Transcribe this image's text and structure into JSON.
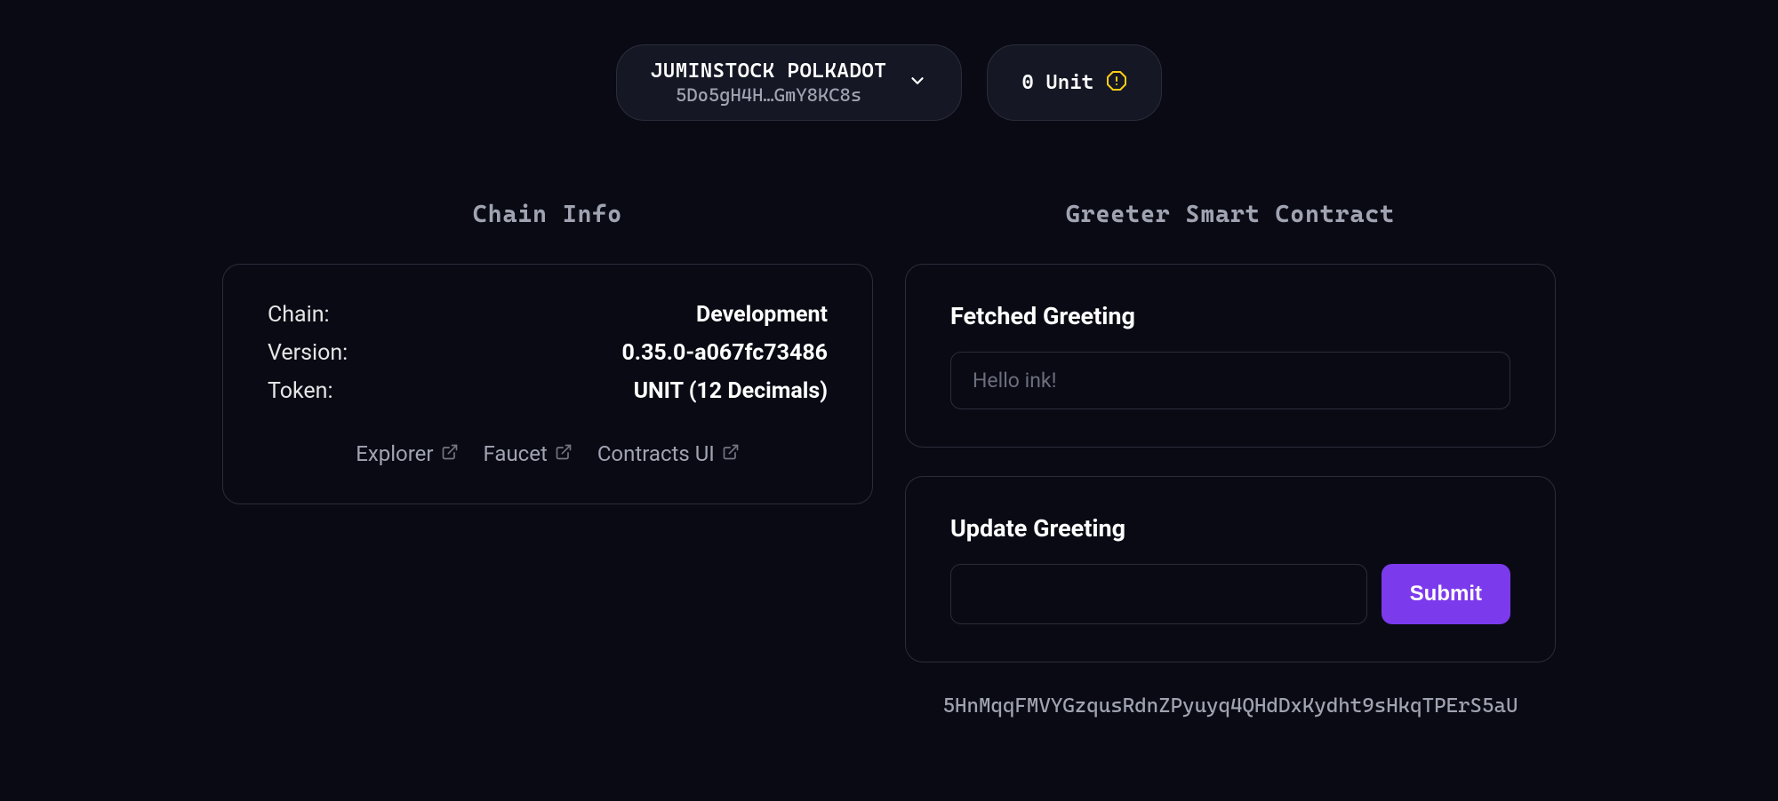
{
  "header": {
    "account": {
      "name": "JUMINSTOCK POLKADOT",
      "address": "5Do5gH4H…GmY8KC8s"
    },
    "balance": {
      "text": "0 Unit"
    }
  },
  "chain_info": {
    "title": "Chain Info",
    "rows": [
      {
        "label": "Chain:",
        "value": "Development"
      },
      {
        "label": "Version:",
        "value": "0.35.0-a067fc73486"
      },
      {
        "label": "Token:",
        "value": "UNIT (12 Decimals)"
      }
    ],
    "links": [
      {
        "label": "Explorer"
      },
      {
        "label": "Faucet"
      },
      {
        "label": "Contracts UI"
      }
    ]
  },
  "greeter": {
    "title": "Greeter Smart Contract",
    "fetched": {
      "heading": "Fetched Greeting",
      "value": "Hello ink!"
    },
    "update": {
      "heading": "Update Greeting",
      "submit_label": "Submit"
    },
    "footer_address": "5HnMqqFMVYGzqusRdnZPyuyq4QHdDxKydht9sHkqTPErS5aU"
  }
}
